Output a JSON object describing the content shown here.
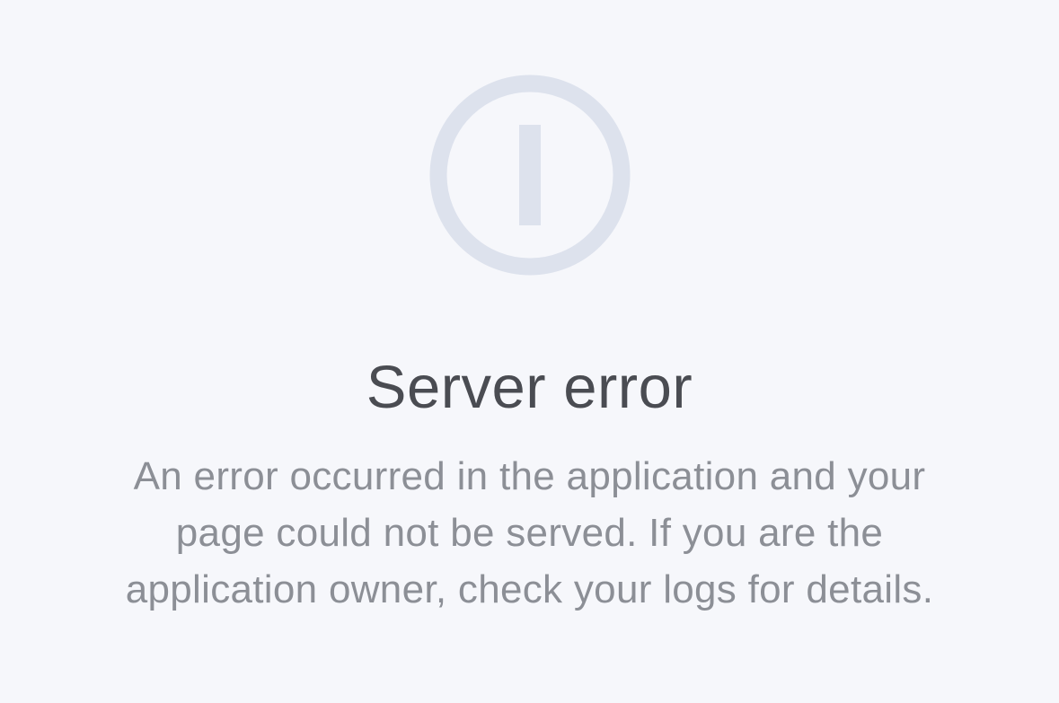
{
  "error": {
    "icon": "exclamation-circle-icon",
    "title": "Server error",
    "message_lines": [
      "An error occurred in the application and your",
      "page could not be served. If you are the",
      "application owner, check your logs for details."
    ]
  },
  "colors": {
    "background": "#f6f7fb",
    "icon": "#dde2ed",
    "title": "#4a4c52",
    "message": "#8c8f96"
  }
}
